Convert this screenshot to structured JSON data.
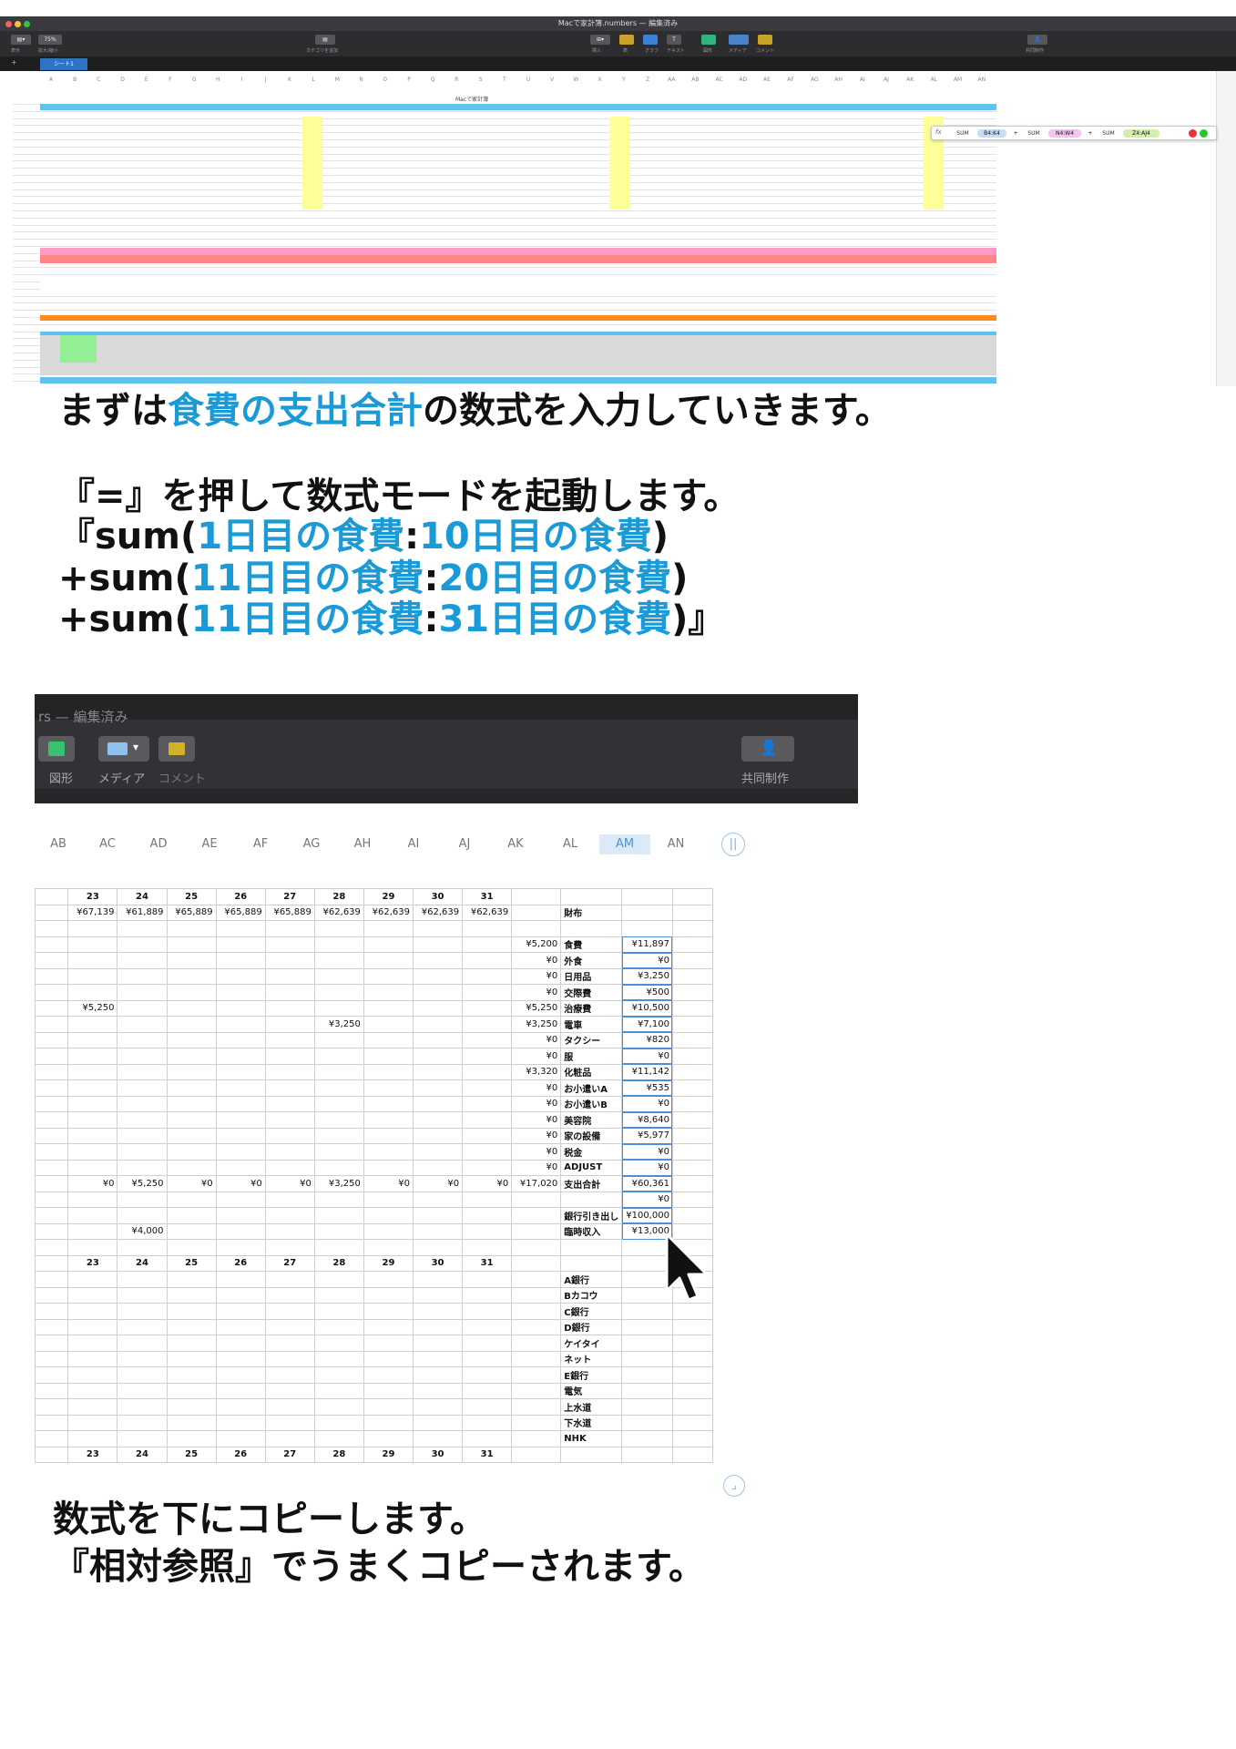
{
  "top_screenshot": {
    "window_title": "Macで家計簿.numbers — 編集済み",
    "zoom": "75%",
    "toolbar_labels": [
      "表示",
      "拡大/縮小",
      "カテゴリを追加",
      "挿入",
      "表",
      "グラフ",
      "テキスト",
      "図形",
      "メディア",
      "コメント",
      "共同制作"
    ],
    "sheet_tab": "シート1",
    "sheet_title": "Macで家計簿",
    "columns": [
      "A",
      "B",
      "C",
      "D",
      "E",
      "F",
      "G",
      "H",
      "I",
      "J",
      "K",
      "L",
      "M",
      "N",
      "O",
      "P",
      "Q",
      "R",
      "S",
      "T",
      "U",
      "V",
      "W",
      "X",
      "Y",
      "Z",
      "AA",
      "AB",
      "AC",
      "AD",
      "AE",
      "AF",
      "AG",
      "AH",
      "AI",
      "AJ",
      "AK",
      "AL",
      "AM",
      "AN"
    ],
    "formula": {
      "fx": "fx",
      "parts": [
        "SUM",
        "B4:K4",
        "SUM",
        "N4:W4",
        "SUM",
        "Z4:AJ4"
      ],
      "plus": "+"
    }
  },
  "captions": {
    "c1_a": "まずは",
    "c1_b": "食費の支出合計",
    "c1_c": "の数式を入力していきます。",
    "c2": "『=』を押して数式モードを起動します。",
    "c3_a": "『sum(",
    "c3_b": "1日目の食費",
    "c3_c": ":",
    "c3_d": "10日目の食費",
    "c3_e": ")",
    "c4_a": "+sum(",
    "c4_b": "11日目の食費",
    "c4_c": ":",
    "c4_d": "20日目の食費",
    "c4_e": ")",
    "c5_a": "+sum(",
    "c5_b": "11日目の食費",
    "c5_c": ":",
    "c5_d": "31日目の食費",
    "c5_e": ")』",
    "c6": "数式を下にコピーします。",
    "c7": "『相対参照』でうまくコピーされます。"
  },
  "zoom_screenshot": {
    "title": "rs — 編集済み",
    "toolbar": [
      "図形",
      "メディア",
      "コメント",
      "共同制作"
    ],
    "columns": [
      "AB",
      "AC",
      "AD",
      "AE",
      "AF",
      "AG",
      "AH",
      "AI",
      "AJ",
      "AK",
      "AL",
      "AM",
      "AN"
    ],
    "day_headers": [
      "23",
      "24",
      "25",
      "26",
      "27",
      "28",
      "29",
      "30",
      "31"
    ],
    "wallet_label": "財布",
    "wallet_row": [
      "¥67,139",
      "¥61,889",
      "¥65,889",
      "¥65,889",
      "¥65,889",
      "¥62,639",
      "¥62,639",
      "¥62,639",
      "¥62,639"
    ],
    "category_rows": [
      {
        "ak": "¥5,200",
        "label": "食費",
        "am": "¥11,897"
      },
      {
        "ak": "¥0",
        "label": "外食",
        "am": "¥0"
      },
      {
        "ak": "¥0",
        "label": "日用品",
        "am": "¥3,250"
      },
      {
        "ak": "¥0",
        "label": "交際費",
        "am": "¥500"
      },
      {
        "ab": "¥5,250",
        "ak": "¥5,250",
        "label": "治療費",
        "am": "¥10,500"
      },
      {
        "ag": "¥3,250",
        "ak": "¥3,250",
        "label": "電車",
        "am": "¥7,100"
      },
      {
        "ak": "¥0",
        "label": "タクシー",
        "am": "¥820"
      },
      {
        "ak": "¥0",
        "label": "服",
        "am": "¥0"
      },
      {
        "ak": "¥3,320",
        "label": "化粧品",
        "am": "¥11,142"
      },
      {
        "ak": "¥0",
        "label": "お小遣いA",
        "am": "¥535"
      },
      {
        "ak": "¥0",
        "label": "お小遣いB",
        "am": "¥0"
      },
      {
        "ak": "¥0",
        "label": "美容院",
        "am": "¥8,640"
      },
      {
        "ak": "¥0",
        "label": "家の設備",
        "am": "¥5,977"
      },
      {
        "ak": "¥0",
        "label": "税金",
        "am": "¥0"
      }
    ],
    "adjust": {
      "ak": "¥0",
      "label": "ADJUST",
      "am": "¥0"
    },
    "total_row": {
      "values": [
        "¥0",
        "¥5,250",
        "¥0",
        "¥0",
        "¥0",
        "¥3,250",
        "¥0",
        "¥0",
        "¥0"
      ],
      "ak": "¥17,020",
      "label": "支出合計",
      "am": "¥60,361"
    },
    "zero_row_am": "¥0",
    "withdraw": {
      "label": "銀行引き出し",
      "am": "¥100,000"
    },
    "temp_income": {
      "ac": "¥4,000",
      "label": "臨時収入",
      "am": "¥13,000"
    },
    "account_labels": [
      "A銀行",
      "Bカコウ",
      "C銀行",
      "D銀行",
      "ケイタイ",
      "ネット",
      "E銀行",
      "電気",
      "上水道",
      "下水道",
      "NHK"
    ],
    "account_green": [
      true,
      false,
      true,
      true,
      false,
      false,
      true,
      false,
      false,
      false,
      false
    ]
  }
}
